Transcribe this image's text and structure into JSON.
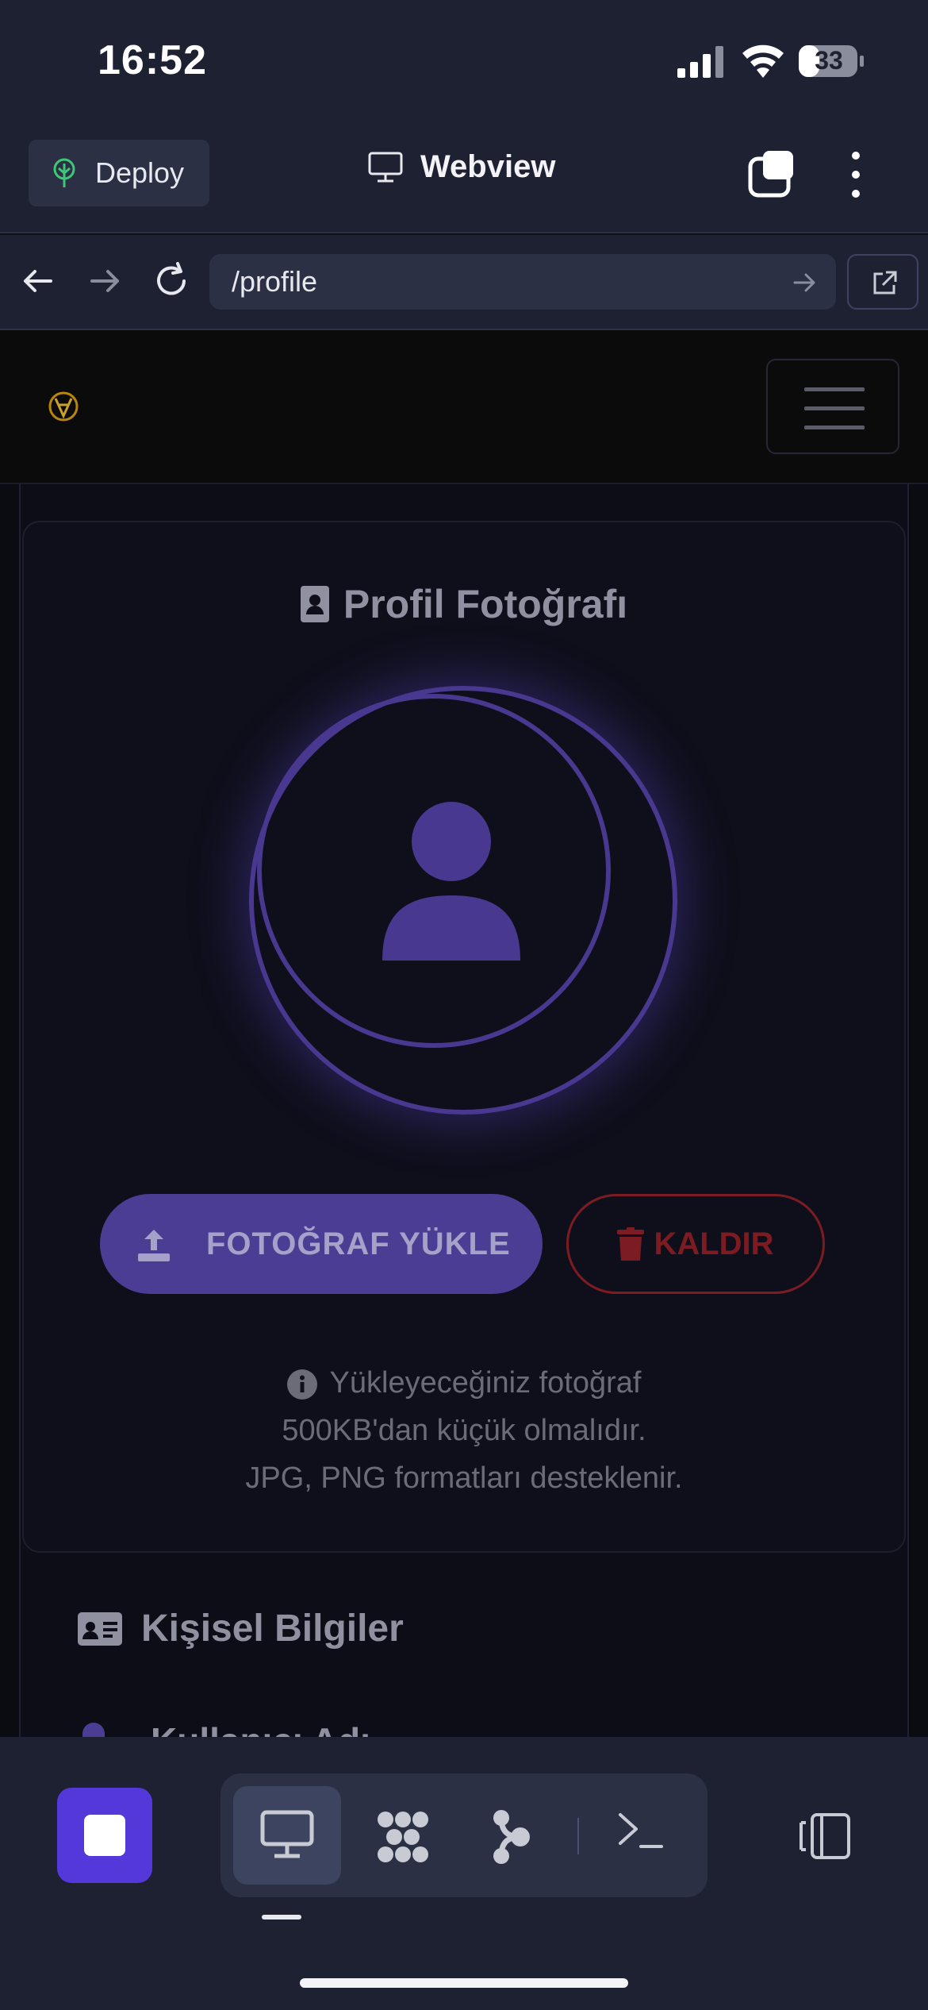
{
  "status": {
    "time": "16:52",
    "battery": "33"
  },
  "header": {
    "deploy_label": "Deploy",
    "title": "Webview"
  },
  "browser": {
    "url": "/profile"
  },
  "profile_photo": {
    "title": "Profil Fotoğrafı",
    "upload_label": "FOTOĞRAF YÜKLE",
    "remove_label": "KALDIR",
    "info_line1": "Yükleyeceğiniz fotoğraf",
    "info_line2": "500KB'dan küçük olmalıdır.",
    "info_line3": "JPG, PNG formatları desteklenir."
  },
  "personal": {
    "title": "Kişisel Bilgiler",
    "first_field_label": "Kullanıcı Adı"
  },
  "colors": {
    "accent": "#5438d9",
    "danger": "#7c1c22",
    "panel": "#1d2132"
  },
  "toolbar": {
    "icons": [
      "webview-icon",
      "packages-icon",
      "git-icon",
      "shell-icon"
    ]
  }
}
